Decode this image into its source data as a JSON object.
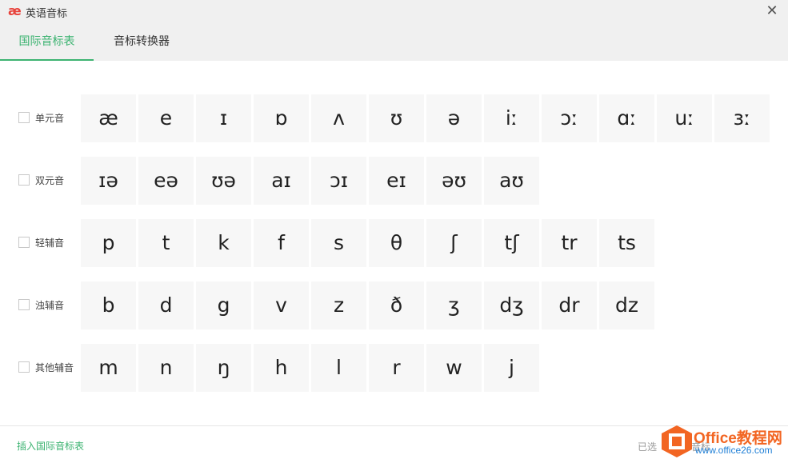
{
  "window": {
    "logo_glyph": "æ",
    "title": "英语音标",
    "close_glyph": "✕"
  },
  "tabs": [
    {
      "label": "国际音标表",
      "active": true
    },
    {
      "label": "音标转换器",
      "active": false
    }
  ],
  "rows": [
    {
      "label": "单元音",
      "checked": false,
      "symbols": [
        "æ",
        "e",
        "ɪ",
        "ɒ",
        "ʌ",
        "ʊ",
        "ə",
        "iː",
        "ɔː",
        "ɑː",
        "uː",
        "ɜː"
      ]
    },
    {
      "label": "双元音",
      "checked": false,
      "symbols": [
        "ɪə",
        "eə",
        "ʊə",
        "aɪ",
        "ɔɪ",
        "eɪ",
        "əʊ",
        "aʊ"
      ]
    },
    {
      "label": "轻辅音",
      "checked": false,
      "symbols": [
        "p",
        "t",
        "k",
        "f",
        "s",
        "θ",
        "ʃ",
        "tʃ",
        "tr",
        "ts"
      ]
    },
    {
      "label": "浊辅音",
      "checked": false,
      "symbols": [
        "b",
        "d",
        "g",
        "v",
        "z",
        "ð",
        "ʒ",
        "dʒ",
        "dr",
        "dz"
      ]
    },
    {
      "label": "其他辅音",
      "checked": false,
      "symbols": [
        "m",
        "n",
        "ŋ",
        "h",
        "l",
        "r",
        "w",
        "j"
      ]
    }
  ],
  "footer": {
    "insert_label": "插入国际音标表",
    "selected_prefix": "已选",
    "selected_suffix": "音标"
  },
  "watermark": {
    "line1": "Office教程网",
    "line2": "www.office26.com"
  },
  "colors": {
    "accent": "#3cb371",
    "logo": "#e8423b",
    "cell_bg": "#f7f7f7"
  }
}
